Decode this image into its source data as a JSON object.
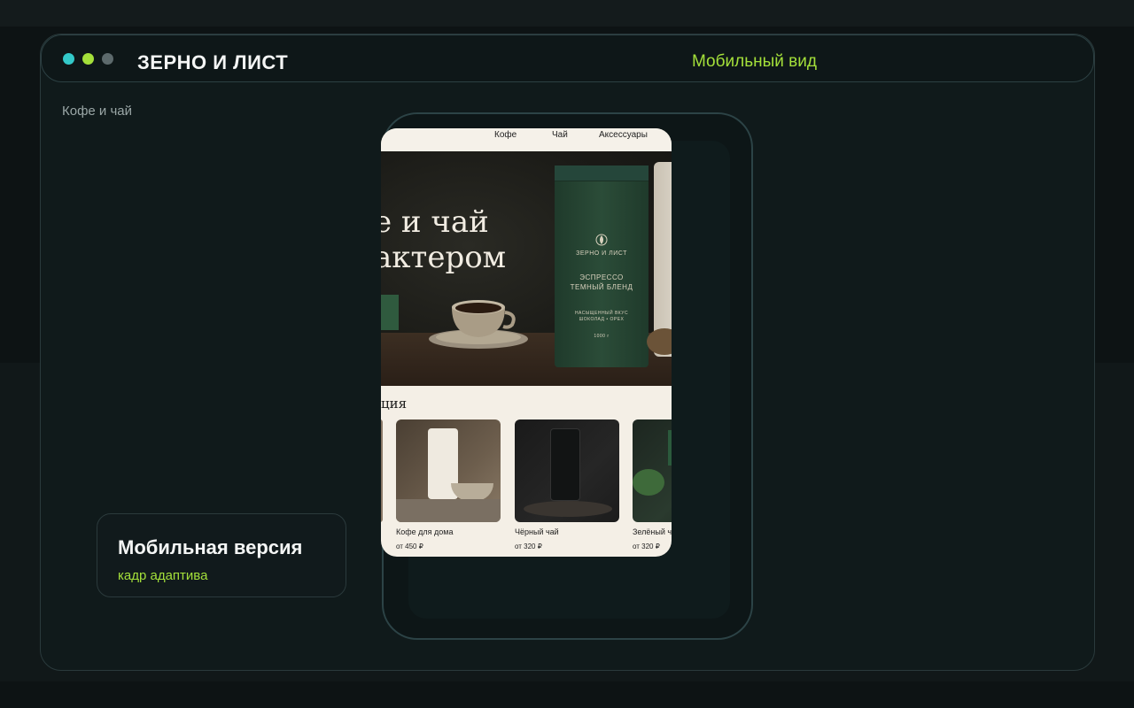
{
  "window": {
    "brand": "ЗЕРНО И ЛИСТ",
    "mode_label": "Мобильный вид",
    "dot_colors": [
      "#33c9c9",
      "#a4e03a",
      "#5d6a6c"
    ]
  },
  "breadcrumb": "Кофе и чай",
  "info_card": {
    "title": "Мобильная версия",
    "subtitle": "кадр адаптива"
  },
  "screen": {
    "nav": [
      "Кофе",
      "Чай",
      "Аксессуары"
    ],
    "hero": {
      "line1": "е и чай",
      "line2": "актером"
    },
    "bag": {
      "brand": "ЗЕРНО И ЛИСТ",
      "name1": "ЭСПРЕССО",
      "name2": "ТЕМНЫЙ БЛЕНД",
      "note": "НАСЫЩЕННЫЙ ВКУС",
      "note2": "ШОКОЛАД • ОРЕХ",
      "weight": "1000 г"
    },
    "section_title": "ция",
    "products": [
      {
        "name": "Кофе для дома",
        "price": "от 450 ₽"
      },
      {
        "name": "Чёрный чай",
        "price": "от 320 ₽"
      },
      {
        "name": "Зелёный ча",
        "price": "от 320 ₽"
      }
    ]
  },
  "colors": {
    "accent": "#a4e03a",
    "bag_green": "#2b4c38",
    "screen_bg": "#f4efe6"
  }
}
